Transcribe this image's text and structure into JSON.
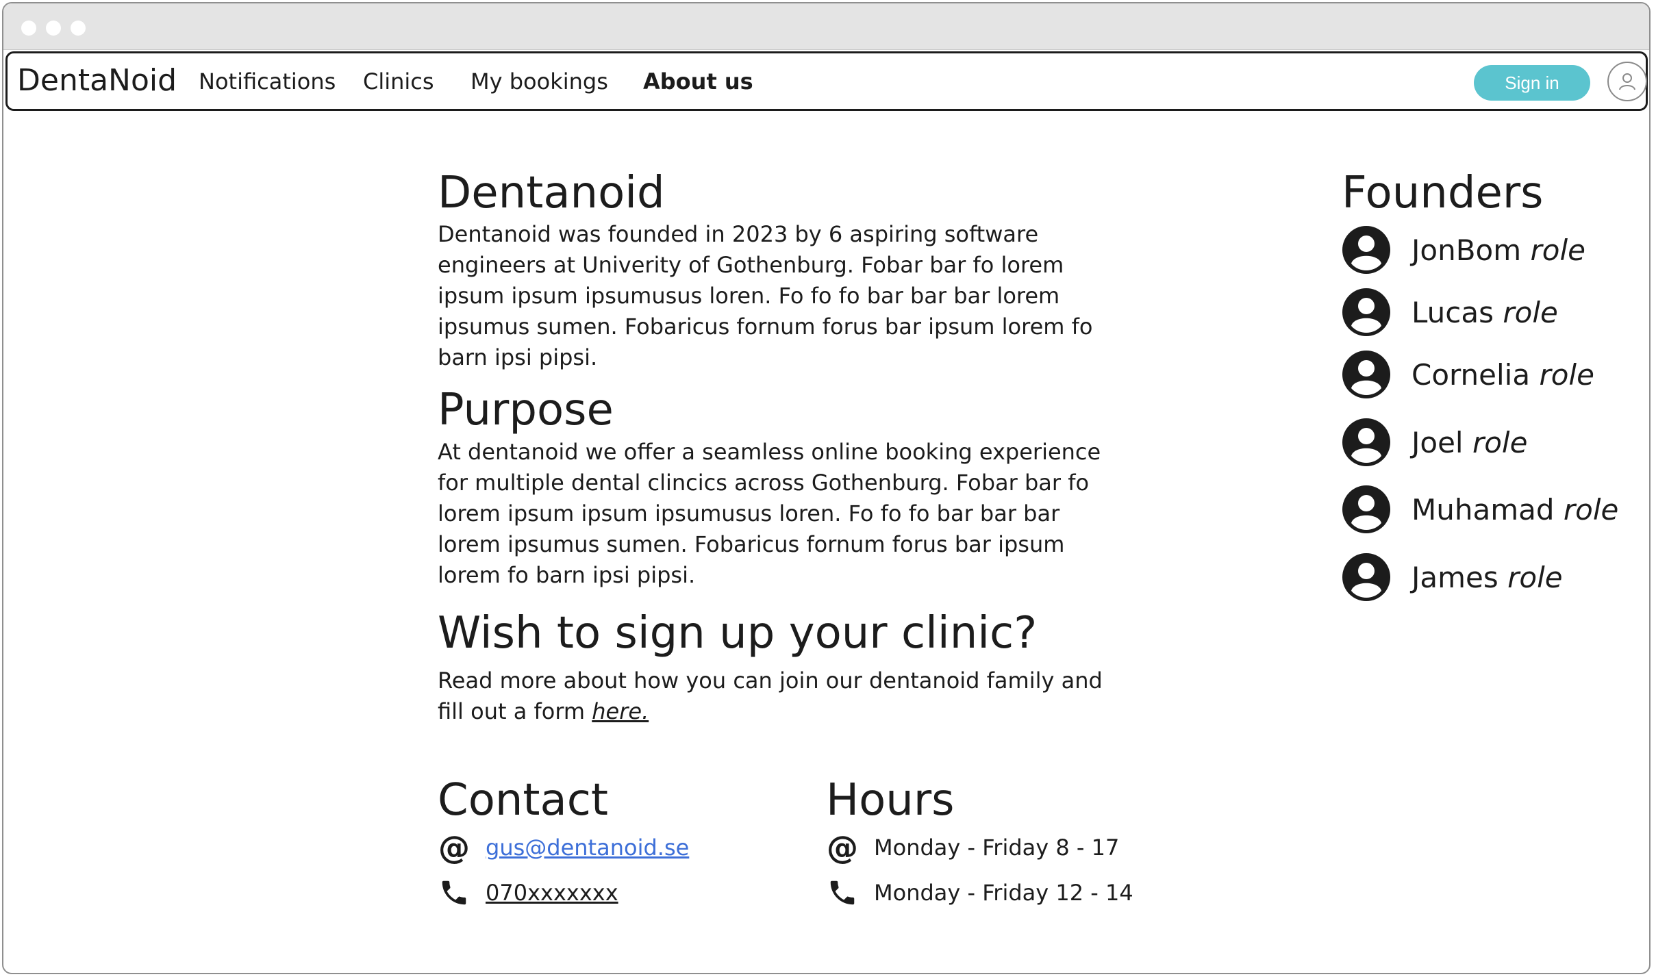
{
  "nav": {
    "brand": "DentaNoid",
    "links": [
      "Notifications",
      "Clinics",
      "My bookings",
      "About us"
    ],
    "signin_label": "Sign in"
  },
  "about": {
    "title": "Dentanoid",
    "text": "Dentanoid was founded in 2023 by 6 aspiring software engineers at Univerity of Gothenburg. Fobar bar fo lorem ipsum ipsum ipsumusus loren. Fo fo fo bar bar bar lorem ipsumus sumen. Fobaricus fornum forus bar ipsum lorem fo barn ipsi pipsi."
  },
  "purpose": {
    "title": "Purpose",
    "text": "At dentanoid we offer a seamless online booking experience for multiple dental clincics across Gothenburg. Fobar bar fo lorem ipsum ipsum ipsumusus loren. Fo fo fo bar bar bar lorem ipsumus sumen. Fobaricus fornum forus bar ipsum lorem fo barn ipsi pipsi."
  },
  "signup": {
    "title": "Wish to sign up your clinic?",
    "text_before": "Read more about how you can join our dentanoid family and fill out a form ",
    "link": "here."
  },
  "contact": {
    "title": "Contact",
    "email": "gus@dentanoid.se",
    "phone": "070xxxxxxx"
  },
  "hours": {
    "title": "Hours",
    "line1": "Monday - Friday 8 - 17",
    "line2": "Monday - Friday 12 - 14"
  },
  "founders": {
    "title": "Founders",
    "people": [
      {
        "name": "JonBom",
        "role": "role"
      },
      {
        "name": "Lucas",
        "role": "role"
      },
      {
        "name": "Cornelia",
        "role": "role"
      },
      {
        "name": "Joel",
        "role": "role"
      },
      {
        "name": "Muhamad",
        "role": "role"
      },
      {
        "name": "James",
        "role": "role"
      }
    ]
  },
  "colors": {
    "accent": "#5bc4cf",
    "link": "#3d6fd8",
    "text": "#1c1c1c"
  },
  "icons": [
    "at-icon",
    "phone-icon",
    "user-icon",
    "person-avatar-icon"
  ]
}
